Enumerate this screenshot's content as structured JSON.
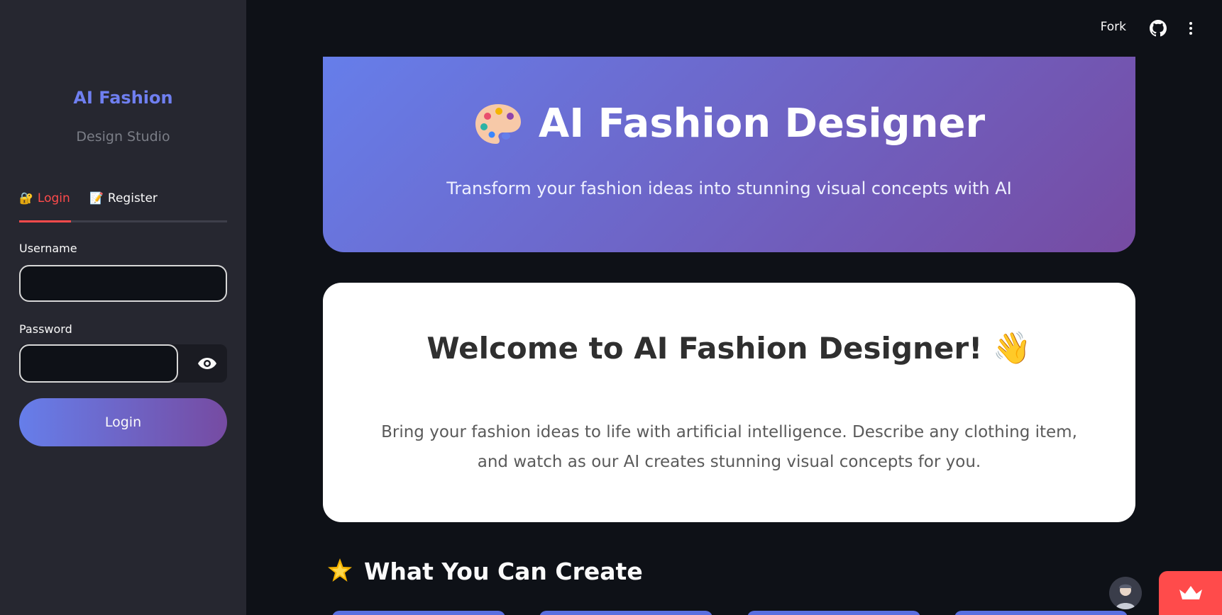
{
  "sidebar": {
    "brand_title": "AI Fashion",
    "brand_subtitle": "Design Studio",
    "tabs": [
      {
        "label": "Login",
        "icon": "lock-icon",
        "active": true
      },
      {
        "label": "Register",
        "icon": "memo-icon",
        "active": false
      }
    ],
    "username_label": "Username",
    "username_value": "",
    "password_label": "Password",
    "password_value": "",
    "login_button": "Login"
  },
  "header": {
    "fork_label": "Fork",
    "github_icon": "github-icon",
    "menu_icon": "kebab-menu-icon"
  },
  "hero": {
    "title": "AI Fashion Designer",
    "icon": "palette-icon",
    "subtitle": "Transform your fashion ideas into stunning visual concepts with AI"
  },
  "welcome": {
    "title": "Welcome to AI Fashion Designer!",
    "emoji": "👋",
    "description": "Bring your fashion ideas to life with artificial intelligence. Describe any clothing item, and watch as our AI creates stunning visual concepts for you."
  },
  "section": {
    "title": "What You Can Create",
    "icon": "star-icon"
  },
  "colors": {
    "accent_red": "#ff4b4b",
    "gradient_start": "#667eea",
    "gradient_end": "#764ba2",
    "sidebar_bg": "#262730",
    "main_bg": "#0e1117"
  }
}
